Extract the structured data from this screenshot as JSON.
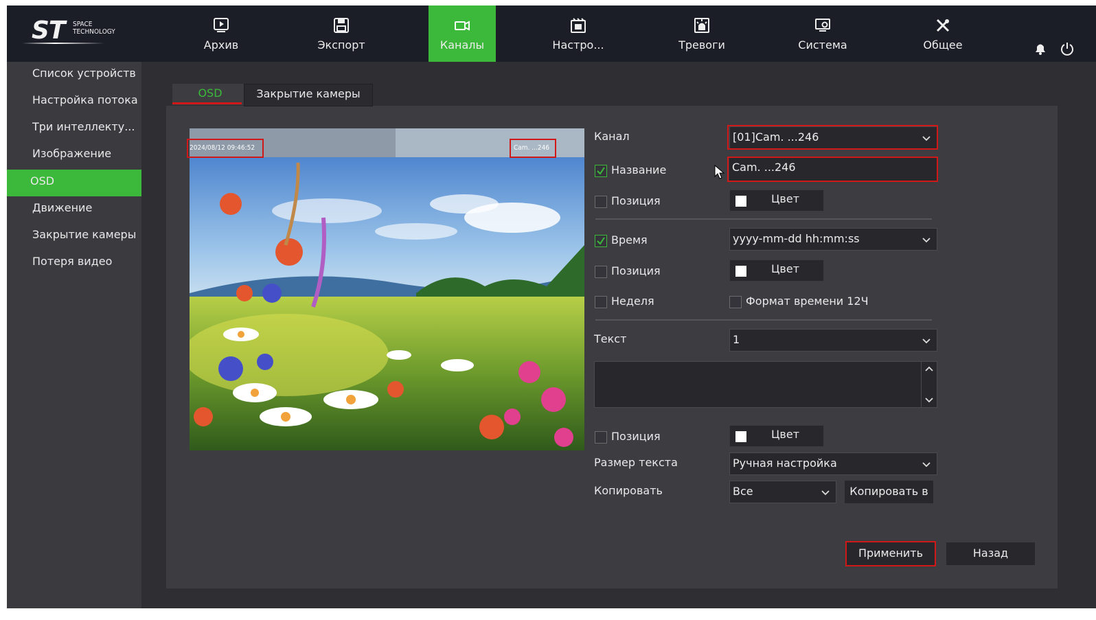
{
  "logo": {
    "mark": "ST",
    "subtitle_line1": "SPACE",
    "subtitle_line2": "TECHNOLOGY"
  },
  "nav": {
    "items": [
      {
        "label": "Архив",
        "icon": "play-icon"
      },
      {
        "label": "Экспорт",
        "icon": "save-icon"
      },
      {
        "label": "Каналы",
        "icon": "camera-icon",
        "active": true
      },
      {
        "label": "Настро...",
        "icon": "settings-film-icon"
      },
      {
        "label": "Тревоги",
        "icon": "alarm-icon"
      },
      {
        "label": "Система",
        "icon": "system-monitor-icon"
      },
      {
        "label": "Общее",
        "icon": "tools-icon"
      }
    ],
    "right_icons": [
      "bell-icon",
      "power-icon"
    ]
  },
  "sidebar": {
    "items": [
      {
        "label": "Список устройств"
      },
      {
        "label": "Настройка потока"
      },
      {
        "label": "Три интеллекту..."
      },
      {
        "label": "Изображение"
      },
      {
        "label": "OSD",
        "active": true
      },
      {
        "label": "Движение"
      },
      {
        "label": "Закрытие камеры"
      },
      {
        "label": "Потеря видео"
      }
    ]
  },
  "tabs": {
    "osd": "OSD",
    "cover": "Закрытие камеры"
  },
  "preview": {
    "timestamp": "2024/08/12 09:46:52",
    "channel_name": "Cam. ...246"
  },
  "form": {
    "channel": {
      "label": "Канал",
      "value": "[01]Cam. ...246"
    },
    "name": {
      "label": "Название",
      "checked": true,
      "value": "Cam. ...246"
    },
    "name_position": {
      "label": "Позиция",
      "checked": false,
      "color_label": "Цвет"
    },
    "time": {
      "label": "Время",
      "checked": true,
      "value": "yyyy-mm-dd hh:mm:ss"
    },
    "time_position": {
      "label": "Позиция",
      "checked": false,
      "color_label": "Цвет"
    },
    "week": {
      "label": "Неделя",
      "checked": false
    },
    "format12": {
      "label": "Формат времени 12Ч",
      "checked": false
    },
    "text": {
      "label": "Текст",
      "value": "1",
      "content": ""
    },
    "text_position": {
      "label": "Позиция",
      "checked": false,
      "color_label": "Цвет"
    },
    "text_size": {
      "label": "Размер текста",
      "value": "Ручная настройка"
    },
    "copy": {
      "label": "Копировать",
      "value": "Все",
      "button": "Копировать в"
    }
  },
  "actions": {
    "apply": "Применить",
    "back": "Назад"
  },
  "colors": {
    "accent": "#3cb93a",
    "highlight": "#d01818",
    "topbar": "#1b1d27",
    "panel": "#2f2f33"
  }
}
